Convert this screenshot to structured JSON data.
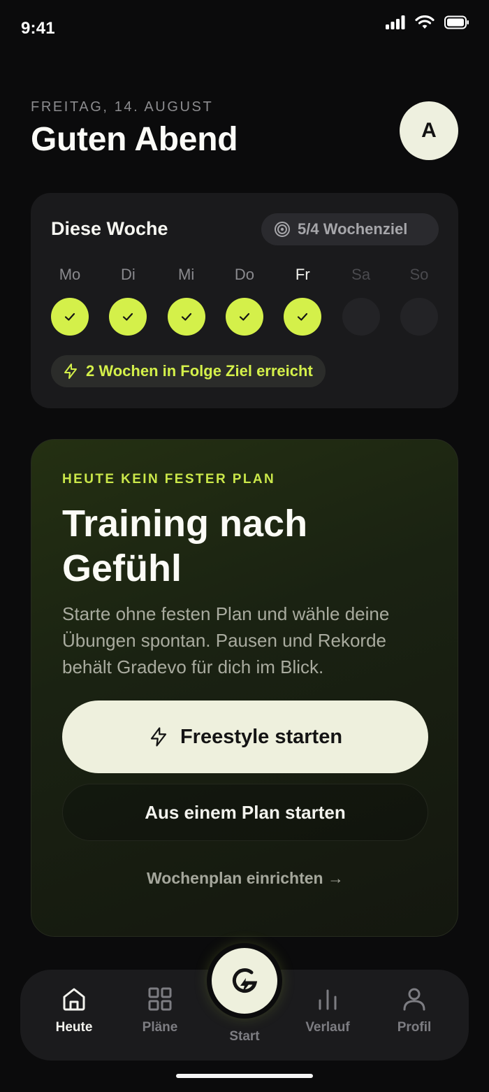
{
  "status": {
    "time": "9:41"
  },
  "header": {
    "date": "FREITAG, 14. AUGUST",
    "greeting": "Guten Abend",
    "avatar_initial": "A"
  },
  "week": {
    "title": "Diese Woche",
    "goal": "5/4 Wochenziel",
    "days": [
      {
        "label": "Mo",
        "done": true
      },
      {
        "label": "Di",
        "done": true
      },
      {
        "label": "Mi",
        "done": true
      },
      {
        "label": "Do",
        "done": true
      },
      {
        "label": "Fr",
        "done": true
      },
      {
        "label": "Sa",
        "done": false
      },
      {
        "label": "So",
        "done": false
      }
    ],
    "streak": "2 Wochen in Folge Ziel erreicht"
  },
  "hero": {
    "eyebrow": "HEUTE KEIN FESTER PLAN",
    "title": "Training nach Gefühl",
    "description": "Starte ohne festen Plan und wähle deine Übungen spontan. Pausen und Rekorde behält Gradevo für dich im Blick.",
    "primary_button": "Freestyle starten",
    "secondary_button": "Aus einem Plan starten",
    "link": "Wochenplan einrichten →"
  },
  "tabs": {
    "home": "Heute",
    "plans": "Pläne",
    "start": "Start",
    "history": "Verlauf",
    "profile": "Profil"
  },
  "colors": {
    "accent": "#d4f04a",
    "background": "#0b0b0c",
    "card": "#1a1a1c",
    "button_light": "#eef0dd"
  }
}
